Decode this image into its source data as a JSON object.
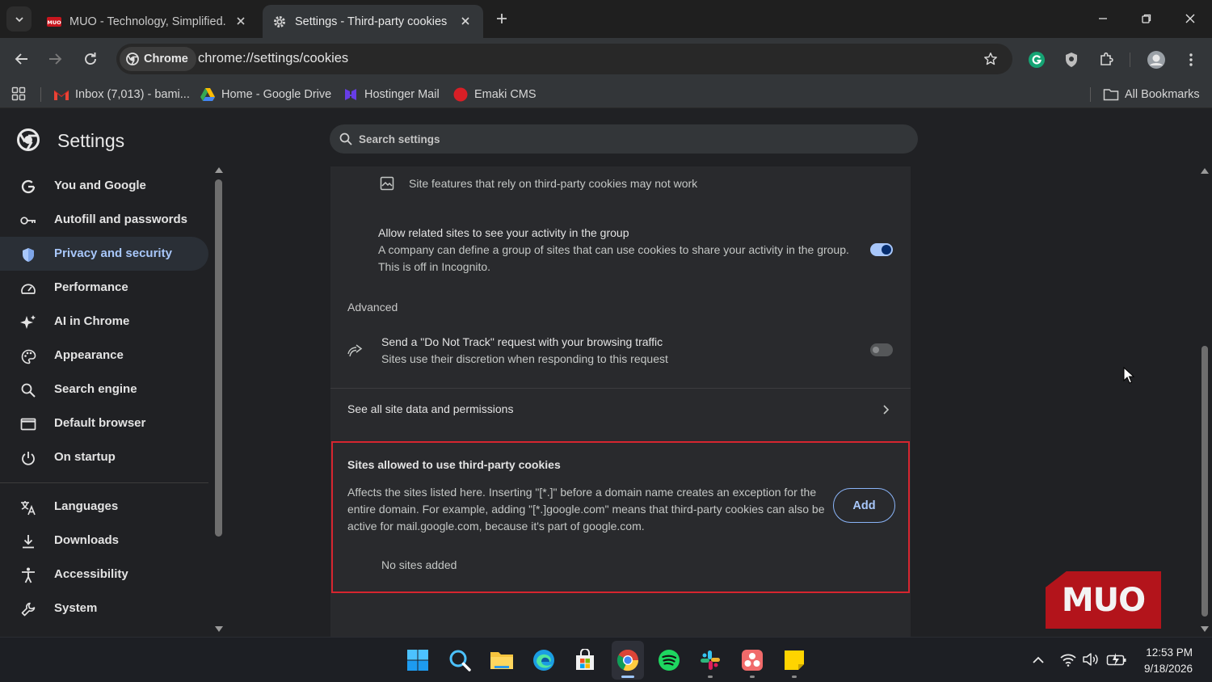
{
  "tabs": [
    {
      "title": "MUO - Technology, Simplified.",
      "favicon": "muo-favicon-icon"
    },
    {
      "title": "Settings - Third-party cookies",
      "favicon": "gear-icon"
    }
  ],
  "omnibox": {
    "chip_label": "Chrome",
    "url": "chrome://settings/cookies"
  },
  "bookmarks": [
    {
      "label": "Inbox (7,013) - bami...",
      "icon": "gmail-icon"
    },
    {
      "label": "Home - Google Drive",
      "icon": "google-drive-icon"
    },
    {
      "label": "Hostinger Mail",
      "icon": "hostinger-icon"
    },
    {
      "label": "Emaki CMS",
      "icon": "emaki-icon"
    }
  ],
  "all_bookmarks": "All Bookmarks",
  "settings": {
    "title": "Settings",
    "search_placeholder": "Search settings"
  },
  "sidebar": {
    "items": [
      {
        "label": "You and Google",
        "icon": "google-g-icon"
      },
      {
        "label": "Autofill and passwords",
        "icon": "key-icon"
      },
      {
        "label": "Privacy and security",
        "icon": "shield-icon",
        "active": true
      },
      {
        "label": "Performance",
        "icon": "speedometer-icon"
      },
      {
        "label": "AI in Chrome",
        "icon": "sparkle-icon"
      },
      {
        "label": "Appearance",
        "icon": "palette-icon"
      },
      {
        "label": "Search engine",
        "icon": "search-icon"
      },
      {
        "label": "Default browser",
        "icon": "browser-window-icon"
      },
      {
        "label": "On startup",
        "icon": "power-icon"
      },
      {
        "label": "Languages",
        "icon": "translate-icon"
      },
      {
        "label": "Downloads",
        "icon": "download-icon"
      },
      {
        "label": "Accessibility",
        "icon": "accessibility-icon"
      },
      {
        "label": "System",
        "icon": "wrench-icon"
      }
    ]
  },
  "content": {
    "features_note": "Site features that rely on third-party cookies may not work",
    "related_sites": {
      "title": "Allow related sites to see your activity in the group",
      "desc_line1": "A company can define a group of sites that can use cookies to share your activity in the group.",
      "desc_line2": "This is off in Incognito.",
      "enabled": true
    },
    "advanced_label": "Advanced",
    "do_not_track": {
      "title": "Send a \"Do Not Track\" request with your browsing traffic",
      "desc": "Sites use their discretion when responding to this request",
      "enabled": false
    },
    "see_all_label": "See all site data and permissions",
    "allowed_sites": {
      "title": "Sites allowed to use third-party cookies",
      "desc_line1": "Affects the sites listed here. Inserting \"[*.]\" before a domain name creates an exception for the",
      "desc_line2": "entire domain. For example, adding \"[*.]google.com\" means that third-party cookies can also be",
      "desc_line3": "active for mail.google.com, because it's part of google.com.",
      "add_label": "Add",
      "empty_label": "No sites added"
    }
  },
  "watermark": "MUO",
  "colors": {
    "accent": "#a8c7fa",
    "highlight_border": "#d6252f",
    "watermark_bg": "#b3141b"
  },
  "taskbar": {
    "apps": [
      "windows-start-icon",
      "search-icon",
      "file-explorer-icon",
      "edge-icon",
      "microsoft-store-icon",
      "chrome-icon",
      "spotify-icon",
      "slack-icon",
      "asana-icon",
      "sticky-notes-icon"
    ],
    "time": "12:53 PM",
    "date": "9/18/2026"
  }
}
